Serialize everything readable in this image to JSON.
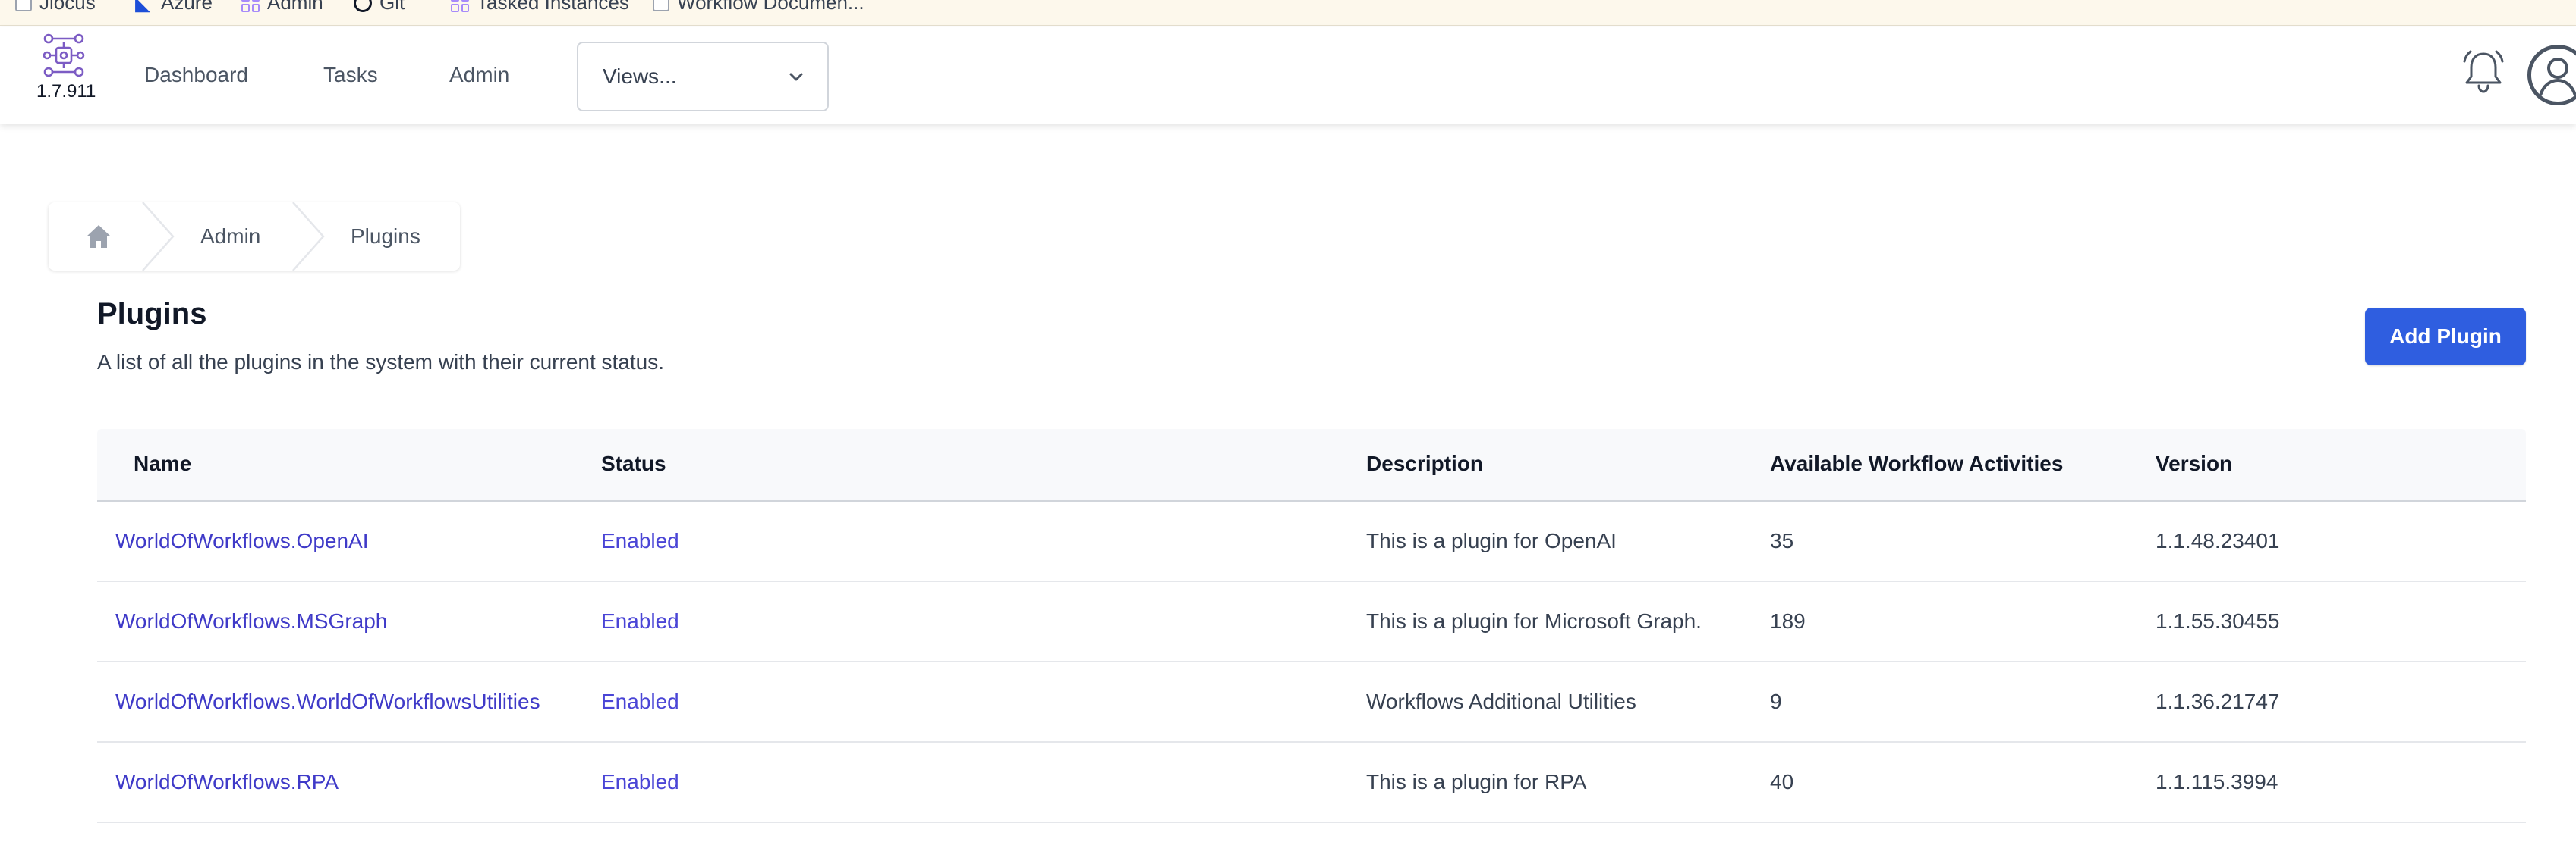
{
  "bookmarks": [
    {
      "label": "Jiocus",
      "icon": "page-icon"
    },
    {
      "label": "Azure",
      "icon": "azure-icon"
    },
    {
      "label": "Admin",
      "icon": "grid-icon"
    },
    {
      "label": "Git",
      "icon": "circle-icon"
    },
    {
      "label": "Tasked Instances",
      "icon": "grid-icon"
    },
    {
      "label": "Workflow Documen...",
      "icon": "page-icon"
    }
  ],
  "navbar": {
    "version": "1.7.911",
    "links": [
      "Dashboard",
      "Tasks",
      "Admin"
    ],
    "views_placeholder": "Views...",
    "icons": [
      "app-logo-icon",
      "chevron-down-icon",
      "bell-icon",
      "user-avatar-icon"
    ]
  },
  "breadcrumb": {
    "home_icon": "home-icon",
    "items": [
      "Admin",
      "Plugins"
    ]
  },
  "header": {
    "title": "Plugins",
    "subtitle": "A list of all the plugins in the system with their current status.",
    "add_button": "Add Plugin"
  },
  "table": {
    "columns": [
      "Name",
      "Status",
      "Description",
      "Available Workflow Activities",
      "Version"
    ],
    "rows": [
      {
        "name": "WorldOfWorkflows.OpenAI",
        "status": "Enabled",
        "description": "This is a plugin for OpenAI",
        "activities": "35",
        "version": "1.1.48.23401"
      },
      {
        "name": "WorldOfWorkflows.MSGraph",
        "status": "Enabled",
        "description": "This is a plugin for Microsoft Graph.",
        "activities": "189",
        "version": "1.1.55.30455"
      },
      {
        "name": "WorldOfWorkflows.WorldOfWorkflowsUtilities",
        "status": "Enabled",
        "description": "Workflows Additional Utilities",
        "activities": "9",
        "version": "1.1.36.21747"
      },
      {
        "name": "WorldOfWorkflows.RPA",
        "status": "Enabled",
        "description": "This is a plugin for RPA",
        "activities": "40",
        "version": "1.1.115.3994"
      }
    ]
  },
  "colors": {
    "primary_button": "#2f5ee0",
    "link": "#3f3ac8",
    "status_enabled": "#4a45d6",
    "logo": "#7c5cc4"
  }
}
